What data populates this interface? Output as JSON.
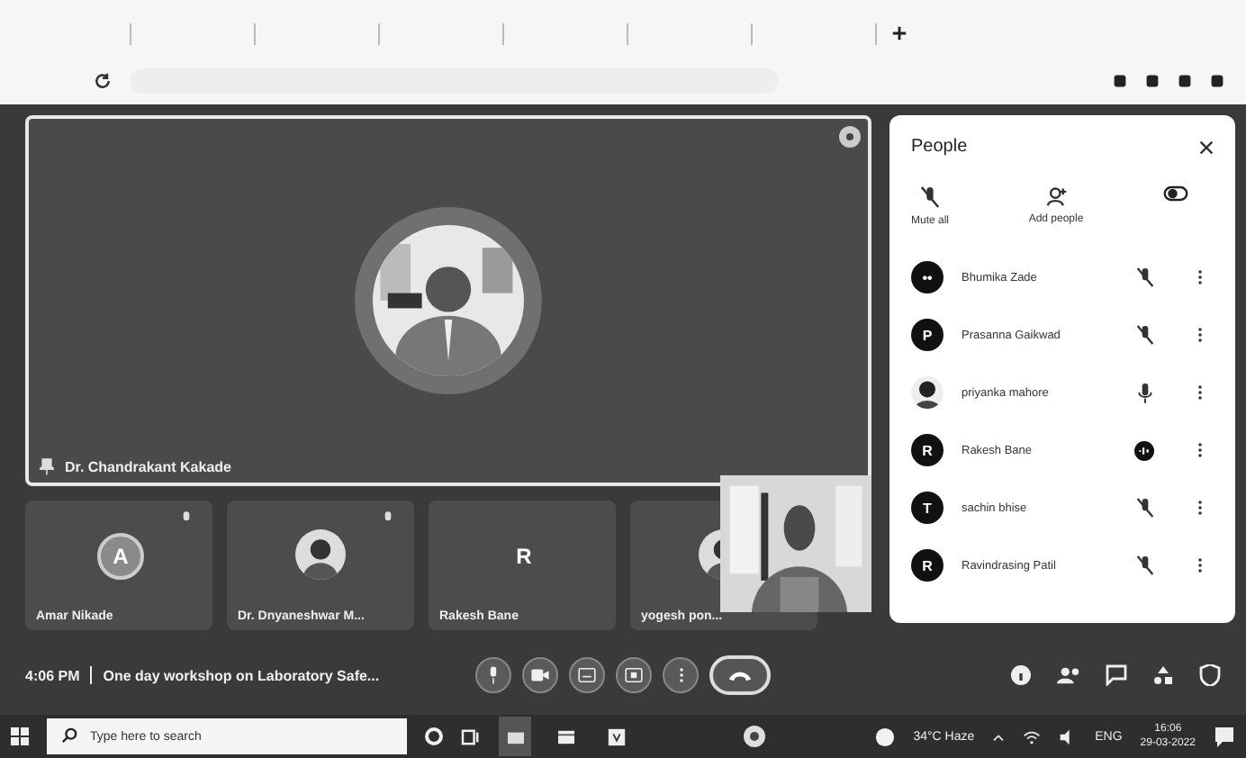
{
  "stage": {
    "pinned_name": "Dr. Chandrakant Kakade"
  },
  "tiles": [
    {
      "name": "Amar Nikade",
      "kind": "letter",
      "initial": "A"
    },
    {
      "name": "Dr. Dnyaneshwar M...",
      "kind": "picture"
    },
    {
      "name": "Rakesh Bane",
      "kind": "letter",
      "initial": "R"
    },
    {
      "name": "yogesh pon...",
      "kind": "picture"
    }
  ],
  "people": {
    "title": "People",
    "actions": [
      "Mute all",
      "Add people"
    ],
    "participants": [
      {
        "name": "Bhumika Zade",
        "kind": "letter",
        "initial": "••",
        "muted": true,
        "speaking": false
      },
      {
        "name": "Prasanna Gaikwad",
        "kind": "letter",
        "initial": "P",
        "muted": true,
        "speaking": false
      },
      {
        "name": "priyanka mahore",
        "kind": "picture",
        "muted": false,
        "speaking": false
      },
      {
        "name": "Rakesh Bane",
        "kind": "letter",
        "initial": "R",
        "muted": false,
        "speaking": true
      },
      {
        "name": "sachin bhise",
        "kind": "letter",
        "initial": "T",
        "muted": true,
        "speaking": false
      },
      {
        "name": "Ravindrasing Patil",
        "kind": "letter",
        "initial": "R",
        "muted": true,
        "speaking": false
      }
    ]
  },
  "meeting_bar": {
    "time": "4:06 PM",
    "title": "One day workshop on Laboratory Safe..."
  },
  "taskbar": {
    "search_placeholder": "Type here to search",
    "weather": "34°C Haze",
    "language": "ENG",
    "time": "16:06",
    "date": "29-03-2022"
  }
}
